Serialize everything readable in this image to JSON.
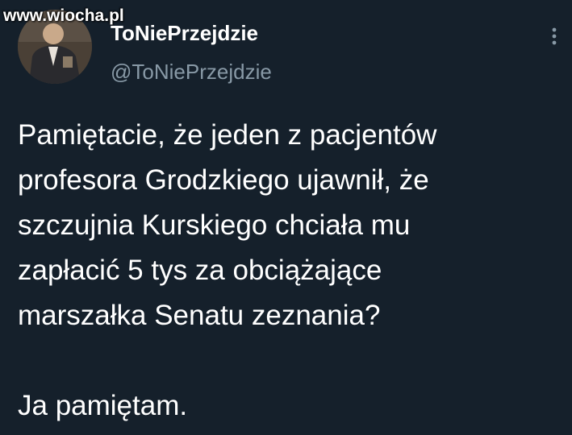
{
  "watermark": "www.wiocha.pl",
  "author": {
    "display_name": "ToNiePrzejdzie",
    "handle": "@ToNiePrzejdzie"
  },
  "icons": {
    "avatar": "profile-photo",
    "more": "vertical-ellipsis-icon"
  },
  "tweet": {
    "paragraph1": [
      "Pamiętacie, że jeden z pacjentów",
      "profesora Grodzkiego ujawnił, że",
      "szczujnia Kurskiego chciała mu",
      "zapłacić 5 tys za obciążające",
      "marszałka Senatu zeznania?"
    ],
    "paragraph2": "Ja pamiętam."
  },
  "colors": {
    "background": "#15202b",
    "text": "#ffffff",
    "secondary_text": "#8899a6"
  }
}
